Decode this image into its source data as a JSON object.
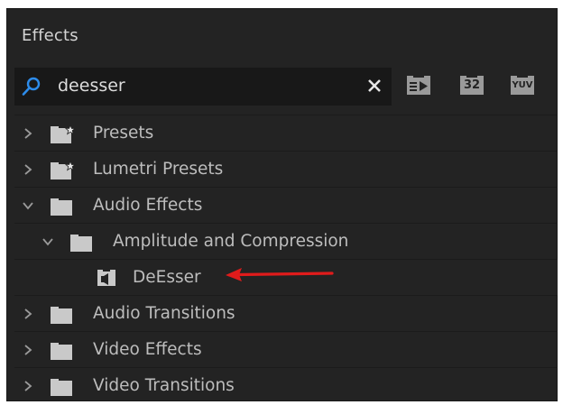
{
  "panel": {
    "title": "Effects"
  },
  "search": {
    "value": "deesser"
  },
  "filters": [
    {
      "label": "",
      "icon": "accelerated-effects-icon"
    },
    {
      "label": "32",
      "icon": "32-bit-color-icon"
    },
    {
      "label": "YUV",
      "icon": "yuv-effects-icon"
    }
  ],
  "tree": [
    {
      "label": "Presets",
      "expanded": false,
      "icon": "preset-folder-icon"
    },
    {
      "label": "Lumetri Presets",
      "expanded": false,
      "icon": "preset-folder-icon"
    },
    {
      "label": "Audio Effects",
      "expanded": true,
      "icon": "folder-icon"
    },
    {
      "label": "Amplitude and Compression",
      "expanded": true,
      "icon": "folder-icon"
    },
    {
      "label": "DeEsser",
      "icon": "audio-effect-icon"
    },
    {
      "label": "Audio Transitions",
      "expanded": false,
      "icon": "folder-icon"
    },
    {
      "label": "Video Effects",
      "expanded": false,
      "icon": "folder-icon"
    },
    {
      "label": "Video Transitions",
      "expanded": false,
      "icon": "folder-icon"
    }
  ],
  "colors": {
    "panel_bg": "#232323",
    "search_bg": "#181818",
    "text": "#bdbdbd",
    "accent_search": "#2d8ceb",
    "annotation_arrow": "#e01b1b"
  }
}
